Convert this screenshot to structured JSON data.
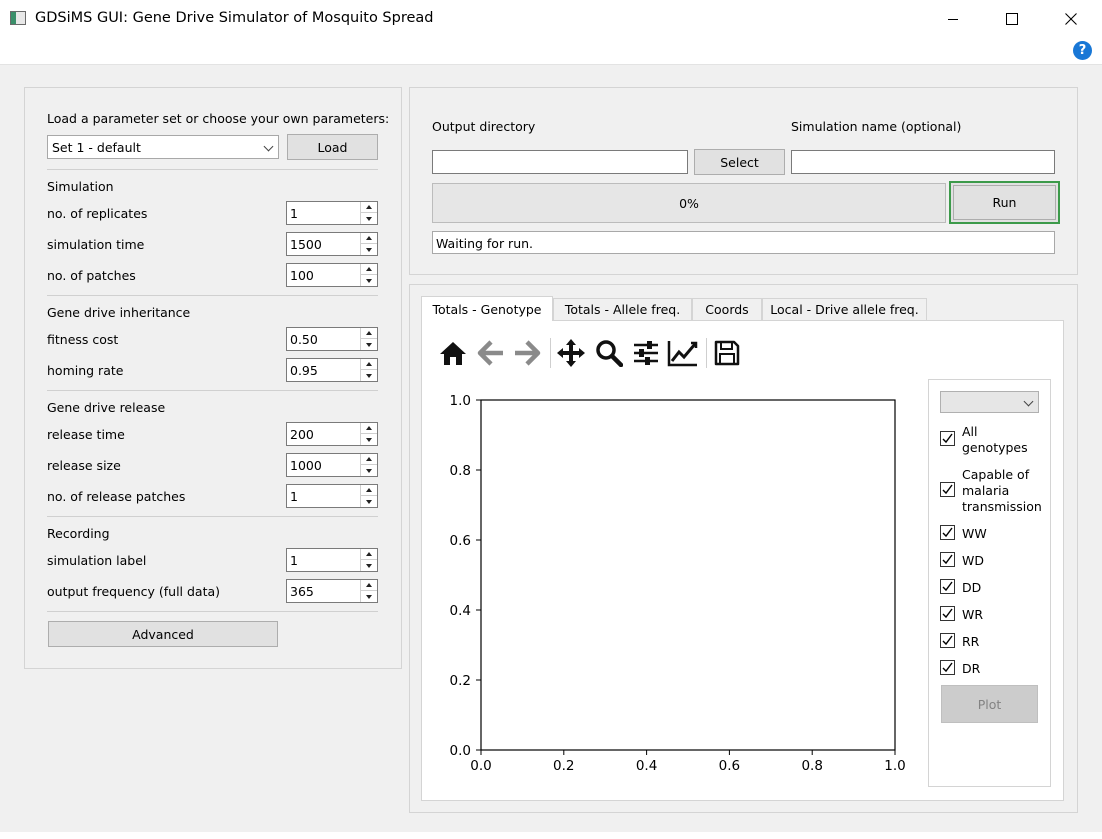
{
  "window": {
    "title": "GDSiMS GUI: Gene Drive Simulator of Mosquito Spread"
  },
  "help": {
    "label": "?"
  },
  "params": {
    "intro": "Load a parameter set or choose your own parameters:",
    "preset_value": "Set 1 - default",
    "load_label": "Load",
    "simulation": {
      "header": "Simulation",
      "replicates_label": "no. of replicates",
      "replicates_value": "1",
      "time_label": "simulation time",
      "time_value": "1500",
      "patches_label": "no. of patches",
      "patches_value": "100"
    },
    "inheritance": {
      "header": "Gene drive inheritance",
      "fitness_label": "fitness cost",
      "fitness_value": "0.50",
      "homing_label": "homing rate",
      "homing_value": "0.95"
    },
    "release": {
      "header": "Gene drive release",
      "time_label": "release time",
      "time_value": "200",
      "size_label": "release size",
      "size_value": "1000",
      "patches_label": "no. of release patches",
      "patches_value": "1"
    },
    "recording": {
      "header": "Recording",
      "label_label": "simulation label",
      "label_value": "1",
      "freq_label": "output frequency (full data)",
      "freq_value": "365"
    },
    "advanced_label": "Advanced"
  },
  "run_panel": {
    "outdir_label": "Output directory",
    "outdir_value": "",
    "select_label": "Select",
    "simname_label": "Simulation name (optional)",
    "simname_value": "",
    "progress_text": "0%",
    "progress_fraction": 0,
    "run_label": "Run",
    "status_text": "Waiting for run."
  },
  "tabs": [
    "Totals - Genotype",
    "Totals - Allele freq.",
    "Coords",
    "Local - Drive allele freq."
  ],
  "toolbar": [
    "home-icon",
    "back-icon",
    "forward-icon",
    "pan-icon",
    "zoom-icon",
    "configure-subplots-icon",
    "edit-axis-icon",
    "save-icon"
  ],
  "plot_side": {
    "select_value": "",
    "options": [
      {
        "label": "All genotypes",
        "checked": true
      },
      {
        "label": "Capable of malaria transmission",
        "checked": true
      },
      {
        "label": "WW",
        "checked": true
      },
      {
        "label": "WD",
        "checked": true
      },
      {
        "label": "DD",
        "checked": true
      },
      {
        "label": "WR",
        "checked": true
      },
      {
        "label": "RR",
        "checked": true
      },
      {
        "label": "DR",
        "checked": true
      }
    ],
    "opt0_line1": "All",
    "opt0_line2": "genotypes",
    "opt1_line1": "Capable of",
    "opt1_line2": "malaria",
    "opt1_line3": "transmission",
    "plot_label": "Plot"
  },
  "chart_data": {
    "type": "line",
    "series": [],
    "xlim": [
      0.0,
      1.0
    ],
    "ylim": [
      0.0,
      1.0
    ],
    "xticks": [
      "0.0",
      "0.2",
      "0.4",
      "0.6",
      "0.8",
      "1.0"
    ],
    "yticks": [
      "0.0",
      "0.2",
      "0.4",
      "0.6",
      "0.8",
      "1.0"
    ],
    "grid": false
  },
  "colors": {
    "run_focus": "#3c9a4a",
    "help_blue": "#1877d6"
  }
}
